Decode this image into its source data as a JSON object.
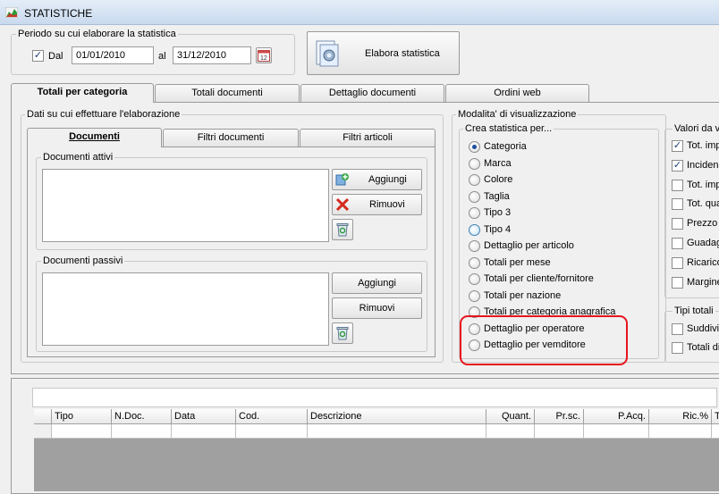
{
  "window": {
    "title": "STATISTICHE"
  },
  "period": {
    "group_label": "Periodo su cui elaborare la statistica",
    "from_label": "Dal",
    "from_checked": true,
    "from_value": "01/01/2010",
    "to_label": "al",
    "to_value": "31/12/2010"
  },
  "elabora_button": "Elabora statistica",
  "main_tabs": [
    "Totali per categoria",
    "Totali documenti",
    "Dettaglio documenti",
    "Ordini web"
  ],
  "data_group": {
    "label": "Dati su cui effettuare l'elaborazione",
    "tabs": [
      "Documenti",
      "Filtri documenti",
      "Filtri articoli"
    ],
    "active_docs_label": "Documenti attivi",
    "passive_docs_label": "Documenti passivi",
    "add_label": "Aggiungi",
    "remove_label": "Rimuovi"
  },
  "viz_group": {
    "label": "Modalita' di visualizzazione",
    "create_label": "Crea statistica per...",
    "options": [
      {
        "label": "Categoria",
        "state": "checked"
      },
      {
        "label": "Marca",
        "state": ""
      },
      {
        "label": "Colore",
        "state": ""
      },
      {
        "label": "Taglia",
        "state": ""
      },
      {
        "label": "Tipo 3",
        "state": ""
      },
      {
        "label": "Tipo 4",
        "state": "hover"
      },
      {
        "label": "Dettaglio per articolo",
        "state": ""
      },
      {
        "label": "Totali per mese",
        "state": ""
      },
      {
        "label": "Totali per cliente/fornitore",
        "state": ""
      },
      {
        "label": "Totali per nazione",
        "state": ""
      },
      {
        "label": "Totali per categoria anagrafica",
        "state": ""
      },
      {
        "label": "Dettaglio per operatore",
        "state": ""
      },
      {
        "label": "Dettaglio per vemditore",
        "state": ""
      }
    ],
    "values_label": "Valori da v",
    "values": [
      {
        "label": "Tot. imp",
        "checked": true
      },
      {
        "label": "Incidenz",
        "checked": true
      },
      {
        "label": "Tot. imp",
        "checked": false
      },
      {
        "label": "Tot. qua",
        "checked": false
      },
      {
        "label": "Prezzo r",
        "checked": false
      },
      {
        "label": "Guadag",
        "checked": false
      },
      {
        "label": "Ricarico",
        "checked": false
      },
      {
        "label": "Margine",
        "checked": false
      }
    ],
    "tipi_label": "Tipi totali",
    "tipi": [
      {
        "label": "Suddivi",
        "checked": false
      },
      {
        "label": "Totali di",
        "checked": false
      }
    ]
  },
  "grid": {
    "columns": [
      "Tipo",
      "N.Doc.",
      "Data",
      "Cod.",
      "Descrizione",
      "Quant.",
      "Pr.sc.",
      "P.Acq.",
      "Ric.%",
      "T"
    ]
  },
  "colors": {
    "highlight": "#e8141c",
    "accent": "#1b4f9c"
  }
}
